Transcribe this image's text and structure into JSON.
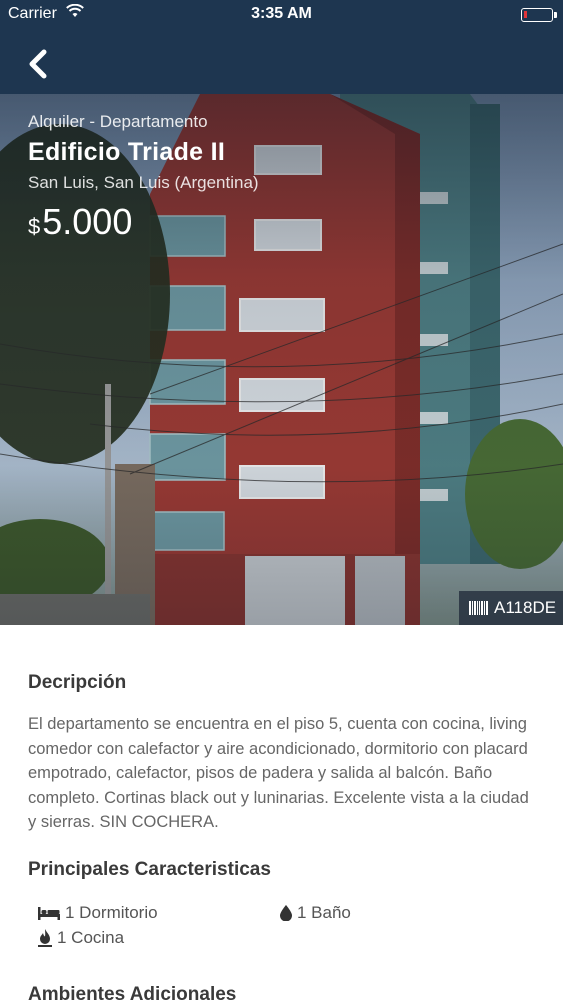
{
  "status_bar": {
    "carrier": "Carrier",
    "time": "3:35 AM"
  },
  "listing": {
    "type": "Alquiler - Departamento",
    "title": "Edificio Triade II",
    "location": "San Luis, San Luis (Argentina)",
    "price_currency": "$",
    "price": "5.000",
    "code": "A118DE"
  },
  "description": {
    "title": "Decripción",
    "text": "El departamento se encuentra en el piso 5, cuenta con cocina, living comedor con calefactor y aire acondicionado, dormitorio con placard empotrado, calefactor, pisos de padera y salida al balcón. Baño completo. Cortinas black out y luninarias. Excelente vista a la ciudad y sierras. SIN COCHERA."
  },
  "features": {
    "title": "Principales Caracteristicas",
    "items": [
      {
        "icon": "bed-icon",
        "label": "1 Dormitorio"
      },
      {
        "icon": "water-drop-icon",
        "label": "1 Baño"
      },
      {
        "icon": "flame-icon",
        "label": "1 Cocina"
      }
    ]
  },
  "additional": {
    "title": "Ambientes Adicionales"
  },
  "colors": {
    "nav_background": "#1e3650",
    "building_red": "#9c3a34",
    "building_teal": "#5c8a8c"
  }
}
